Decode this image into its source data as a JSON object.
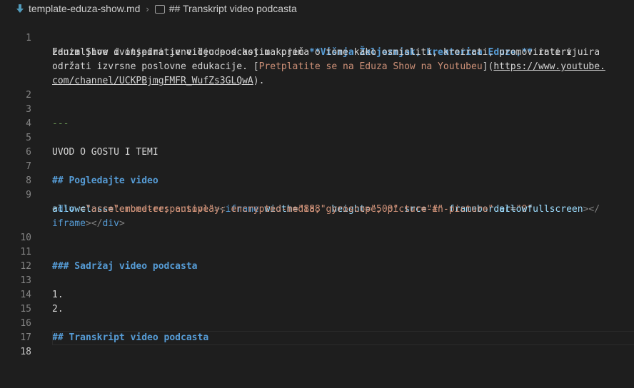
{
  "breadcrumb": {
    "file": "template-eduza-show.md",
    "section": "## Transkript video podcasta"
  },
  "lines": {
    "l1": {
      "num": "1",
      "pre": "Eduza Show dvotjedni je video podcast u kojem ",
      "bold_open": "**",
      "bold_text": "Višnja Željeznjak, kreatorica Eduze,",
      "bold_close": "**",
      "post": " intervjuira"
    },
    "l1b": {
      "text": "zanimljive i inspirativne ljude s kojima priča o tome kako osmisliti, kreirati, promovirati i"
    },
    "l1c": {
      "pre": "održati izvrsne poslovne edukacije. ",
      "link_open": "[",
      "link_text": "Pretplatite se na Eduza Show na Youtubeu",
      "link_mid": "](",
      "url_a": "https://www.youtube."
    },
    "l1d": {
      "url_b": "com/channel/UCKPBjmgFMFR_WufZs3GLQwA",
      "close": ")."
    },
    "l2": {
      "num": "2"
    },
    "l3": {
      "num": "3",
      "text": "---"
    },
    "l4": {
      "num": "4"
    },
    "l5": {
      "num": "5",
      "text": "UVOD O GOSTU I TEMI"
    },
    "l6": {
      "num": "6"
    },
    "l7": {
      "num": "7",
      "text": "## Pogledajte video"
    },
    "l8": {
      "num": "8"
    },
    "l9": {
      "num": "9",
      "lt": "<",
      "tag1": "div",
      "a_class": " class",
      "eq1": "=",
      "v_class": "\"embed-responsive\"",
      "gt_lt": "><",
      "tag2": "iframe",
      "a_width": " width",
      "eq2": "=",
      "v_width": "\"888\"",
      "a_height": " height",
      "eq3": "=",
      "v_height": "\"500\"",
      "a_src": " src",
      "eq4": "=",
      "v_src": "\"#\"",
      "a_fb": " frameborder",
      "eq5": "=",
      "v_fb": "\"0\""
    },
    "l9b": {
      "a_allow": "allow",
      "eq": "=",
      "v_allow": "\"accelerometer; autoplay; encrypted-media; gyroscope; picture-in-picture\"",
      "a_afs": " allowfullscreen",
      "close": "></"
    },
    "l9c": {
      "tag": "iframe",
      "mid": "></",
      "tag2": "div",
      "end": ">"
    },
    "l10": {
      "num": "10"
    },
    "l11": {
      "num": "11",
      "text": "### Sadržaj video podcasta"
    },
    "l12": {
      "num": "12"
    },
    "l13": {
      "num": "13",
      "text": "1."
    },
    "l14": {
      "num": "14",
      "text": "2."
    },
    "l15": {
      "num": "15"
    },
    "l16": {
      "num": "16",
      "text": "## Transkript video podcasta"
    },
    "l17": {
      "num": "17"
    },
    "l18": {
      "num": "18"
    }
  },
  "colors": {
    "background": "#1e1e1e",
    "text": "#d4d4d4",
    "heading": "#569cd6",
    "string": "#ce9178",
    "attribute": "#9cdcfe",
    "line_number": "#858585"
  }
}
